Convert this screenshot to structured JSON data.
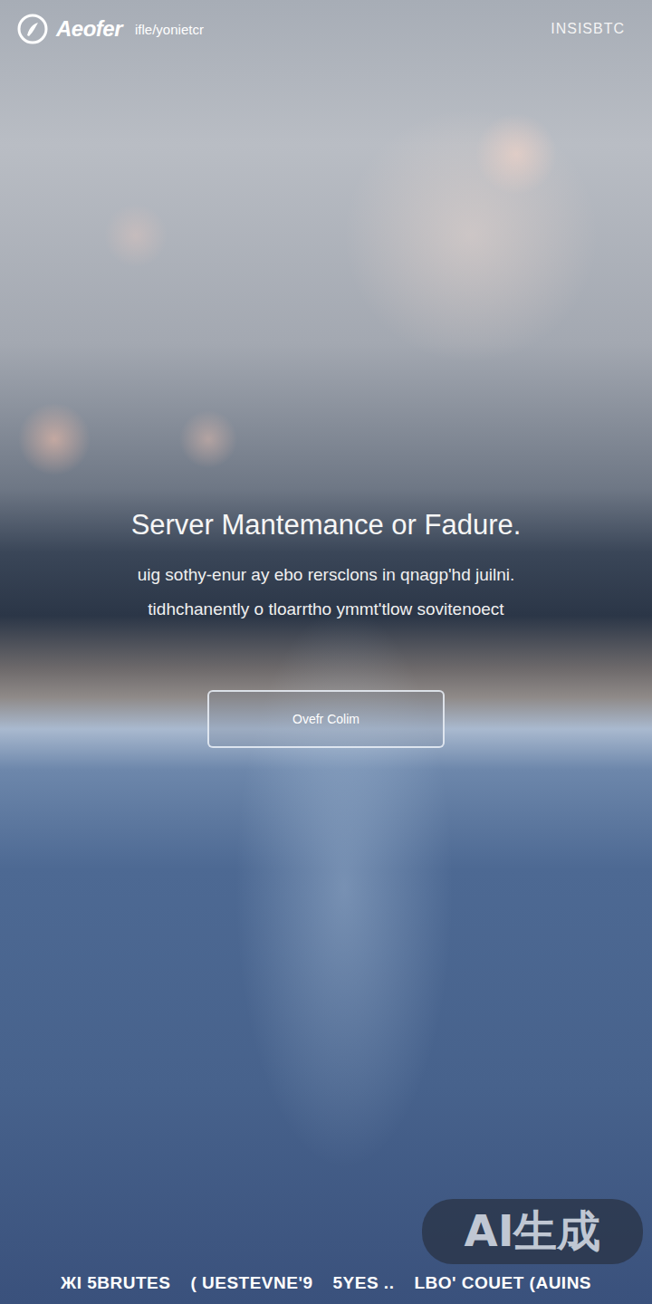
{
  "header": {
    "brand": "Aeofer",
    "tagline": "ifle/yonietcr",
    "right_label": "INSISBTC"
  },
  "hero": {
    "title": "Server Mantemance or Fadure.",
    "lines": [
      "uig sothy-enur ay ebo rersclons in qnagp'hd juilni.",
      "tidhchanently o tloarrtho ymmt'tlow sovitenoect"
    ]
  },
  "button": {
    "label": "Ovefr Colim"
  },
  "footer": {
    "items": [
      "ЖI 5BRUTES",
      "( UESTEVNE'9",
      "5YES ..",
      "LBO' COUET (AUINS"
    ]
  },
  "watermark": "AI生成"
}
